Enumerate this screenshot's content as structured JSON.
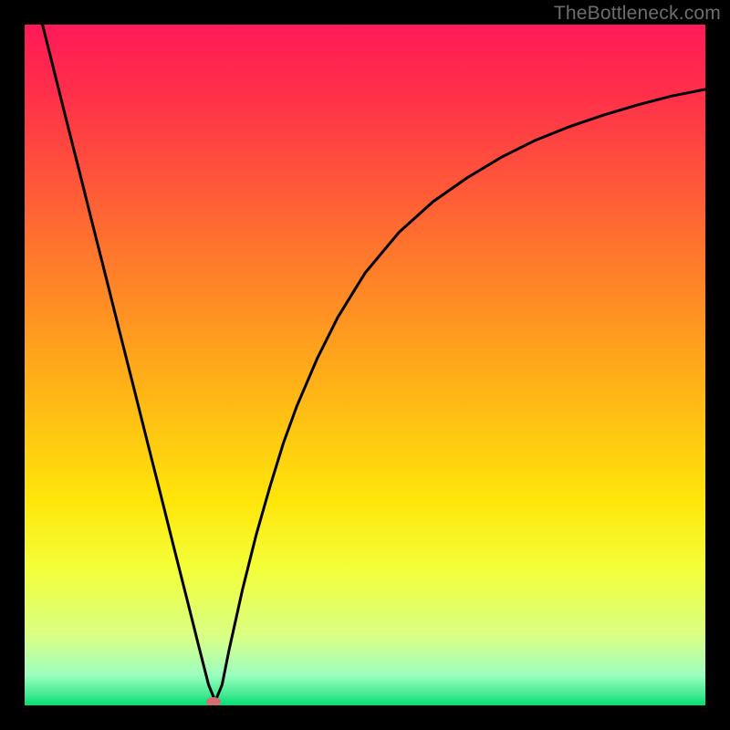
{
  "watermark": "TheBottleneck.com",
  "chart_data": {
    "type": "line",
    "title": "",
    "xlabel": "",
    "ylabel": "",
    "xlim": [
      0,
      100
    ],
    "ylim": [
      0,
      100
    ],
    "grid": false,
    "legend": false,
    "background_gradient": {
      "stops": [
        {
          "pos": 0.0,
          "color": "#ff1a58"
        },
        {
          "pos": 0.1,
          "color": "#ff2f4a"
        },
        {
          "pos": 0.25,
          "color": "#ff5c37"
        },
        {
          "pos": 0.4,
          "color": "#ff8a25"
        },
        {
          "pos": 0.55,
          "color": "#ffb815"
        },
        {
          "pos": 0.7,
          "color": "#ffe60a"
        },
        {
          "pos": 0.8,
          "color": "#f3ff3a"
        },
        {
          "pos": 0.9,
          "color": "#d8ff86"
        },
        {
          "pos": 0.955,
          "color": "#9cffc0"
        },
        {
          "pos": 0.985,
          "color": "#40e98f"
        },
        {
          "pos": 1.0,
          "color": "#00df72"
        }
      ]
    },
    "series": [
      {
        "name": "bottleneck-curve",
        "color": "#000000",
        "stroke_width": 3,
        "x": [
          0,
          2,
          4,
          6,
          8,
          10,
          12,
          14,
          16,
          18,
          20,
          22,
          24,
          25.5,
          27,
          28,
          29,
          30,
          32,
          34,
          36,
          38,
          40,
          43,
          46,
          50,
          55,
          60,
          65,
          70,
          75,
          80,
          85,
          90,
          95,
          100
        ],
        "y": [
          110,
          102.5,
          94.5,
          86.5,
          78.6,
          70.6,
          62.7,
          54.7,
          46.8,
          38.8,
          30.9,
          22.9,
          15.0,
          9.0,
          3.1,
          0.6,
          3.0,
          8.0,
          17.0,
          25.0,
          32.0,
          38.5,
          44.0,
          51.0,
          57.0,
          63.5,
          69.5,
          74.0,
          77.5,
          80.5,
          83.0,
          85.0,
          86.7,
          88.2,
          89.5,
          90.5
        ]
      }
    ],
    "markers": [
      {
        "name": "optimal-point",
        "x": 27.7,
        "y": 0.6,
        "shape": "ellipse",
        "rx": 8,
        "ry": 5,
        "fill": "#d86a74"
      }
    ]
  }
}
